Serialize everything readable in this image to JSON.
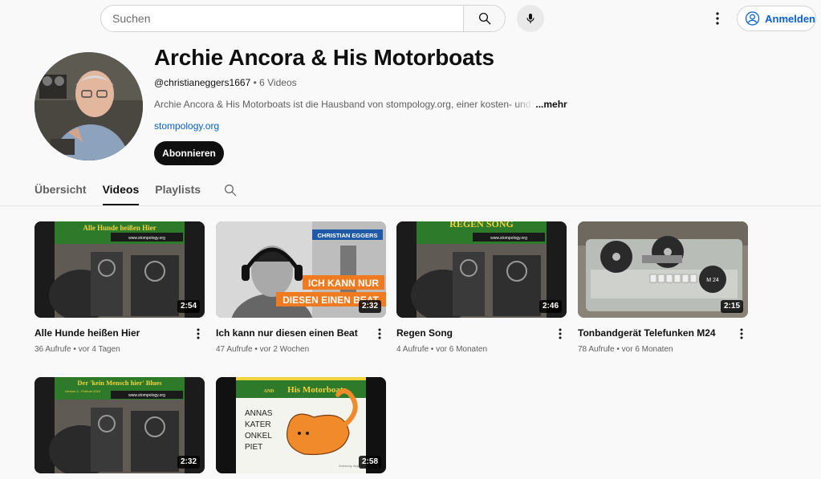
{
  "search": {
    "placeholder": "Suchen"
  },
  "header": {
    "signin_label": "Anmelden"
  },
  "channel": {
    "title": "Archie Ancora & His Motorboats",
    "handle": "@christianeggers1667",
    "sep": " • ",
    "video_count": "6 Videos",
    "description": "Archie Ancora & His Motorboats ist die Hausband von stompology.org, einer kosten-",
    "description_fade": " und",
    "more_label": "...mehr",
    "link": "stompology.org",
    "subscribe_label": "Abonnieren"
  },
  "tabs": [
    {
      "label": "Übersicht"
    },
    {
      "label": "Videos"
    },
    {
      "label": "Playlists"
    }
  ],
  "videos": [
    {
      "title": "Alle Hunde heißen Hier",
      "views": "36 Aufrufe",
      "age": "vor 4 Tagen",
      "duration": "2:54",
      "thumb_banner": "Alle Hunde heißen Hier",
      "thumb_site": "www.stompology.org"
    },
    {
      "title": "Ich kann nur diesen einen Beat",
      "views": "47 Aufrufe",
      "age": "vor 2 Wochen",
      "duration": "2:32",
      "thumb_name": "CHRISTIAN EGGERS",
      "thumb_line1": "ICH KANN NUR",
      "thumb_line2": "DIESEN EINEN BEAT"
    },
    {
      "title": "Regen Song",
      "views": "4 Aufrufe",
      "age": "vor 6 Monaten",
      "duration": "2:46",
      "thumb_banner": "REGEN SONG",
      "thumb_site": "www.stompology.org"
    },
    {
      "title": "Tonbandgerät Telefunken M24",
      "views": "78 Aufrufe",
      "age": "vor 6 Monaten",
      "duration": "2:15",
      "thumb_badge": "M 24"
    },
    {
      "title": "",
      "views": "",
      "age": "",
      "duration": "2:32",
      "thumb_banner": "Der 'kein Mensch hier' Blues",
      "thumb_sub": "Version 2 - Februar 2024",
      "thumb_site": "www.stompology.org"
    },
    {
      "title": "",
      "views": "",
      "age": "",
      "duration": "2:58",
      "thumb_and": "AND",
      "thumb_band": "His Motorboats",
      "thumb_words": [
        "ANNAS",
        "KATER",
        "ONKEL",
        "PIET"
      ],
      "thumb_small": "Zeichnung: Angie Hey"
    }
  ],
  "colors": {
    "banner_green": "#2d7a2b",
    "banner_yellow": "#f2d23c",
    "link_blue": "#065fd4",
    "orange": "#f07a1f"
  },
  "icons": [
    "search-icon",
    "mic-icon",
    "kebab-menu-icon",
    "account-icon",
    "tab-search-icon"
  ]
}
